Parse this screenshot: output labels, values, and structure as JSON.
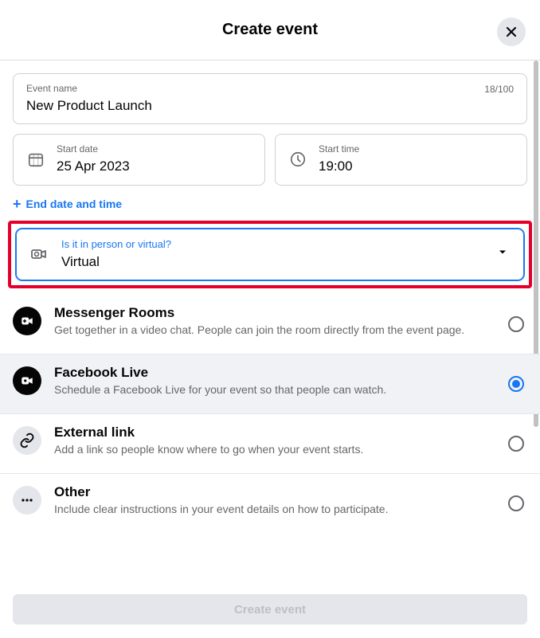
{
  "header": {
    "title": "Create event"
  },
  "eventName": {
    "label": "Event name",
    "value": "New Product Launch",
    "counter": "18/100"
  },
  "startDate": {
    "label": "Start date",
    "value": "25 Apr 2023"
  },
  "startTime": {
    "label": "Start time",
    "value": "19:00"
  },
  "addEnd": {
    "label": "End date and time"
  },
  "locationType": {
    "label": "Is it in person or virtual?",
    "value": "Virtual"
  },
  "options": [
    {
      "title": "Messenger Rooms",
      "desc": "Get together in a video chat. People can join the room directly from the event page."
    },
    {
      "title": "Facebook Live",
      "desc": "Schedule a Facebook Live for your event so that people can watch."
    },
    {
      "title": "External link",
      "desc": "Add a link so people know where to go when your event starts."
    },
    {
      "title": "Other",
      "desc": "Include clear instructions in your event details on how to participate."
    }
  ],
  "footer": {
    "createLabel": "Create event"
  }
}
